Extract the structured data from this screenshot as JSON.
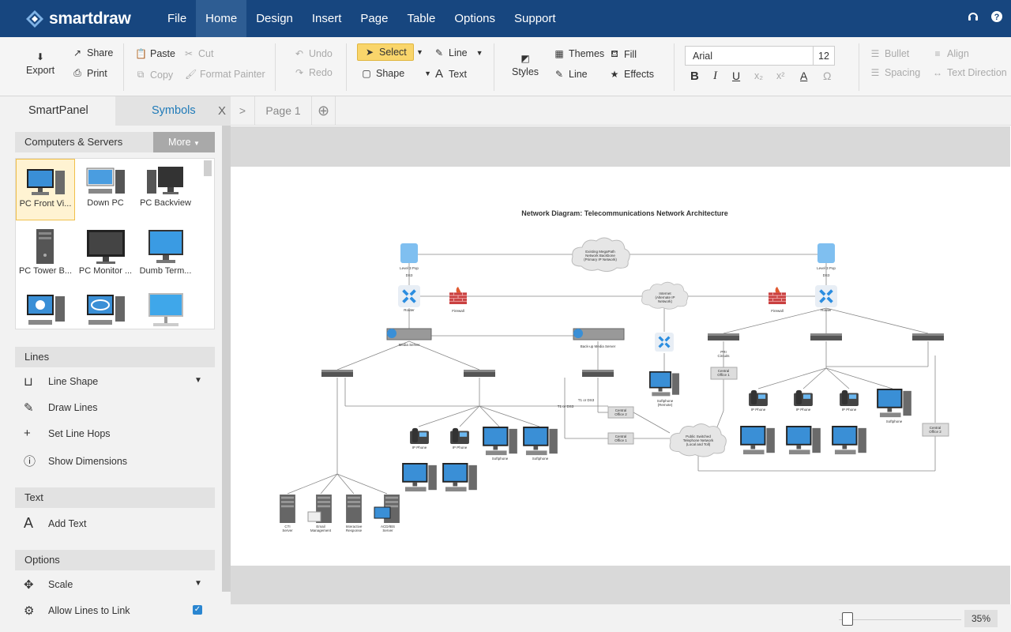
{
  "app": {
    "brand": "smartdraw"
  },
  "menu": [
    "File",
    "Home",
    "Design",
    "Insert",
    "Page",
    "Table",
    "Options",
    "Support"
  ],
  "ribbon": {
    "export": "Export",
    "share": "Share",
    "print": "Print",
    "paste": "Paste",
    "cut": "Cut",
    "copy": "Copy",
    "format_painter": "Format Painter",
    "undo": "Undo",
    "redo": "Redo",
    "select": "Select",
    "line": "Line",
    "shape": "Shape",
    "text": "Text",
    "styles": "Styles",
    "themes": "Themes",
    "fill": "Fill",
    "line2": "Line",
    "effects": "Effects",
    "font": "Arial",
    "font_size": "12",
    "bold": "B",
    "italic": "I",
    "underline": "U",
    "subscript": "x₂",
    "superscript": "x²",
    "font_color": "A",
    "omega": "Ω",
    "bullet": "Bullet",
    "align": "Align",
    "spacing": "Spacing",
    "text_direction": "Text Direction"
  },
  "left_panel": {
    "tabs": [
      "SmartPanel",
      "Symbols"
    ],
    "close": "X",
    "library": "Computers & Servers",
    "more": "More",
    "symbols": [
      "PC Front Vi...",
      "Down PC",
      "PC Backview",
      "PC Tower B...",
      "PC Monitor ...",
      "Dumb Term...",
      "",
      "",
      ""
    ],
    "lines_header": "Lines",
    "lines_items": [
      "Line Shape",
      "Draw Lines",
      "Set Line Hops",
      "Show Dimensions"
    ],
    "text_header": "Text",
    "text_items": [
      "Add Text"
    ],
    "options_header": "Options",
    "options_items": [
      "Scale",
      "Allow Lines to Link"
    ]
  },
  "page_tabs": {
    "toggle": ">",
    "page": "Page 1",
    "add": "+"
  },
  "diagram": {
    "title": "Network Diagram: Telecommunications Network Architecture",
    "labels": {
      "pop_left": "Level 3 Pop",
      "ds3_left": "DS3",
      "pop_right": "Level 3 Pop",
      "ds3_right": "DS3",
      "cloud_top": [
        "Existing MegaPath",
        "Network Backbone",
        "(Primary IP Network)"
      ],
      "cloud_mid": [
        "Internet",
        "(Alternate IP",
        "Network)"
      ],
      "cloud_bottom": [
        "Public Switched",
        "Telephone Network",
        "(Local and Toll)"
      ],
      "router_left": "Router",
      "router_right": "Router",
      "firewall_left": "Firewall",
      "firewall_right": "Firewall",
      "media_server": "Media Server",
      "backup_media_server": "Back-up Media Server",
      "t1_ds3_a": "T1 or DS3",
      "t1_ds3_b": "T1 or DS3",
      "co2_a": [
        "Central",
        "Office 2"
      ],
      "co1_a": [
        "Central",
        "Office 1"
      ],
      "co1_b": [
        "Central",
        "Office 1"
      ],
      "co2_b": [
        "Central",
        "Office 2"
      ],
      "pri": [
        "PRI",
        "Circuits"
      ],
      "softphone_remote": [
        "Softphone",
        "(Remote)"
      ],
      "ip_phone": "IP Phone",
      "softphone": "Softphone",
      "cti": [
        "CTI",
        "Server"
      ],
      "email": [
        "Email",
        "Management"
      ],
      "ivr": [
        "Interactive",
        "Response"
      ],
      "acd": [
        "ACD/IBS",
        "Server"
      ]
    }
  },
  "zoom": {
    "value": "35%",
    "level_fraction": 0.03
  },
  "colors": {
    "topbar": "#17467f",
    "accent": "#1f7ab8",
    "select_btn": "#f9d56b"
  }
}
